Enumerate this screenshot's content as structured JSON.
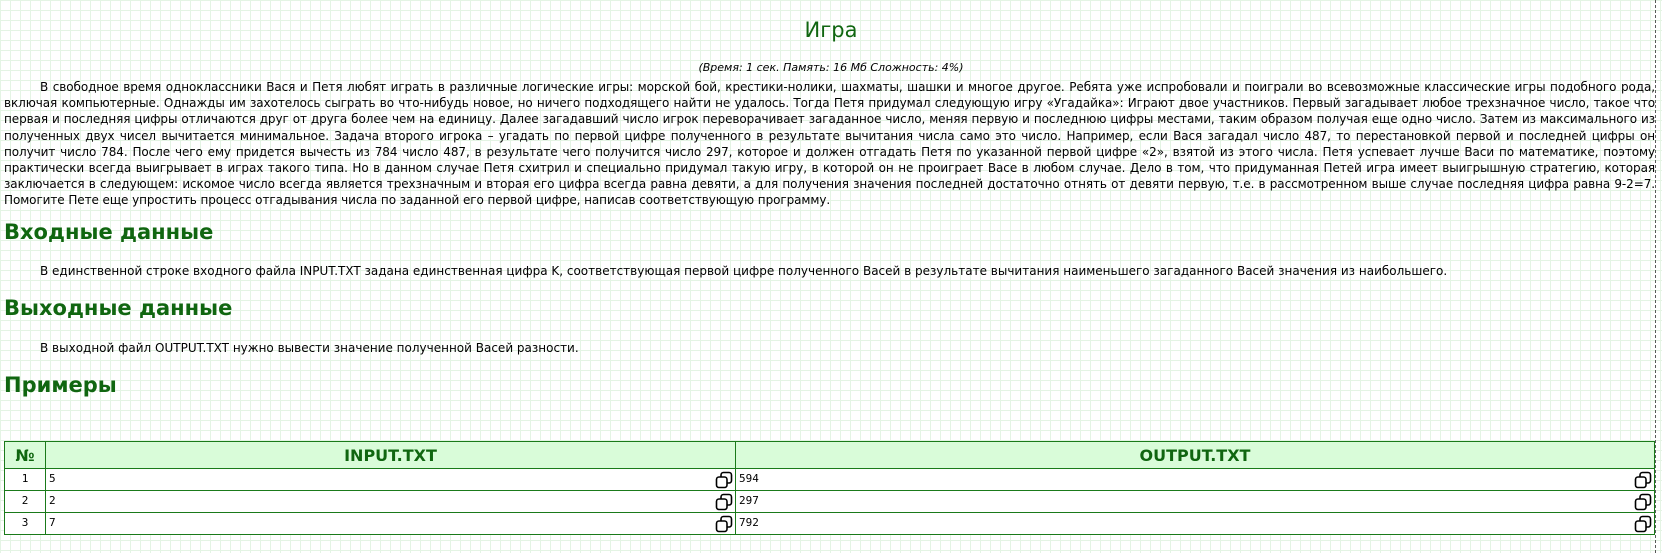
{
  "problem": {
    "title": "Игра",
    "limits": "(Время: 1 сек. Память: 16 Мб Сложность: 4%)",
    "statement": "В свободное время одноклассники Вася и Петя любят играть в различные логические игры: морской бой, крестики-нолики, шахматы, шашки и многое другое. Ребята уже испробовали и поиграли во всевозможные классические игры подобного рода, включая компьютерные. Однажды им захотелось сыграть во что-нибудь новое, но ничего подходящего найти не удалось. Тогда Петя придумал следующую игру «Угадайка»: Играют двое участников. Первый загадывает любое трехзначное число, такое что первая и последняя цифры отличаются друг от друга более чем на единицу. Далее загадавший число игрок переворачивает загаданное число, меняя первую и последнюю цифры местами, таким образом получая еще одно число. Затем из максимального из полученных двух чисел вычитается минимальное. Задача второго игрока – угадать по первой цифре полученного в результате вычитания числа само это число. Например, если Вася загадал число 487, то перестановкой первой и последней цифры он получит число 784. После чего ему придется вычесть из 784 число 487, в результате чего получится число 297, которое и должен отгадать Петя по указанной первой цифре «2», взятой из этого числа. Петя успевает лучше Васи по математике, поэтому практически всегда выигрывает в играх такого типа. Но в данном случае Петя схитрил и специально придумал такую игру, в которой он не проиграет Васе в любом случае. Дело в том, что придуманная Петей игра имеет выигрышную стратегию, которая заключается в следующем: искомое число всегда является трехзначным и вторая его цифра всегда равна девяти, а для получения значения последней достаточно отнять от девяти первую, т.е. в рассмотренном выше случае последняя цифра равна 9-2=7. Помогите Пете еще упростить процесс отгадывания числа по заданной его первой цифре, написав соответствующую программу."
  },
  "input_section": {
    "heading": "Входные данные",
    "text": "В единственной строке входного файла INPUT.TXT задана единственная цифра K, соответствующая первой цифре полученного Васей в результате вычитания наименьшего загаданного Васей значения из наибольшего."
  },
  "output_section": {
    "heading": "Выходные данные",
    "text": "В выходной файл OUTPUT.TXT нужно вывести значение полученной Васей разности."
  },
  "examples": {
    "heading": "Примеры",
    "columns": [
      "№",
      "INPUT.TXT",
      "OUTPUT.TXT"
    ],
    "rows": [
      {
        "n": "1",
        "input": "5",
        "output": "594"
      },
      {
        "n": "2",
        "input": "2",
        "output": "297"
      },
      {
        "n": "3",
        "input": "7",
        "output": "792"
      }
    ],
    "copy_icon": "copy-icon"
  },
  "colors": {
    "heading": "#106610",
    "table_header_bg": "#d9fcd9",
    "table_border": "#1a7a1a"
  }
}
